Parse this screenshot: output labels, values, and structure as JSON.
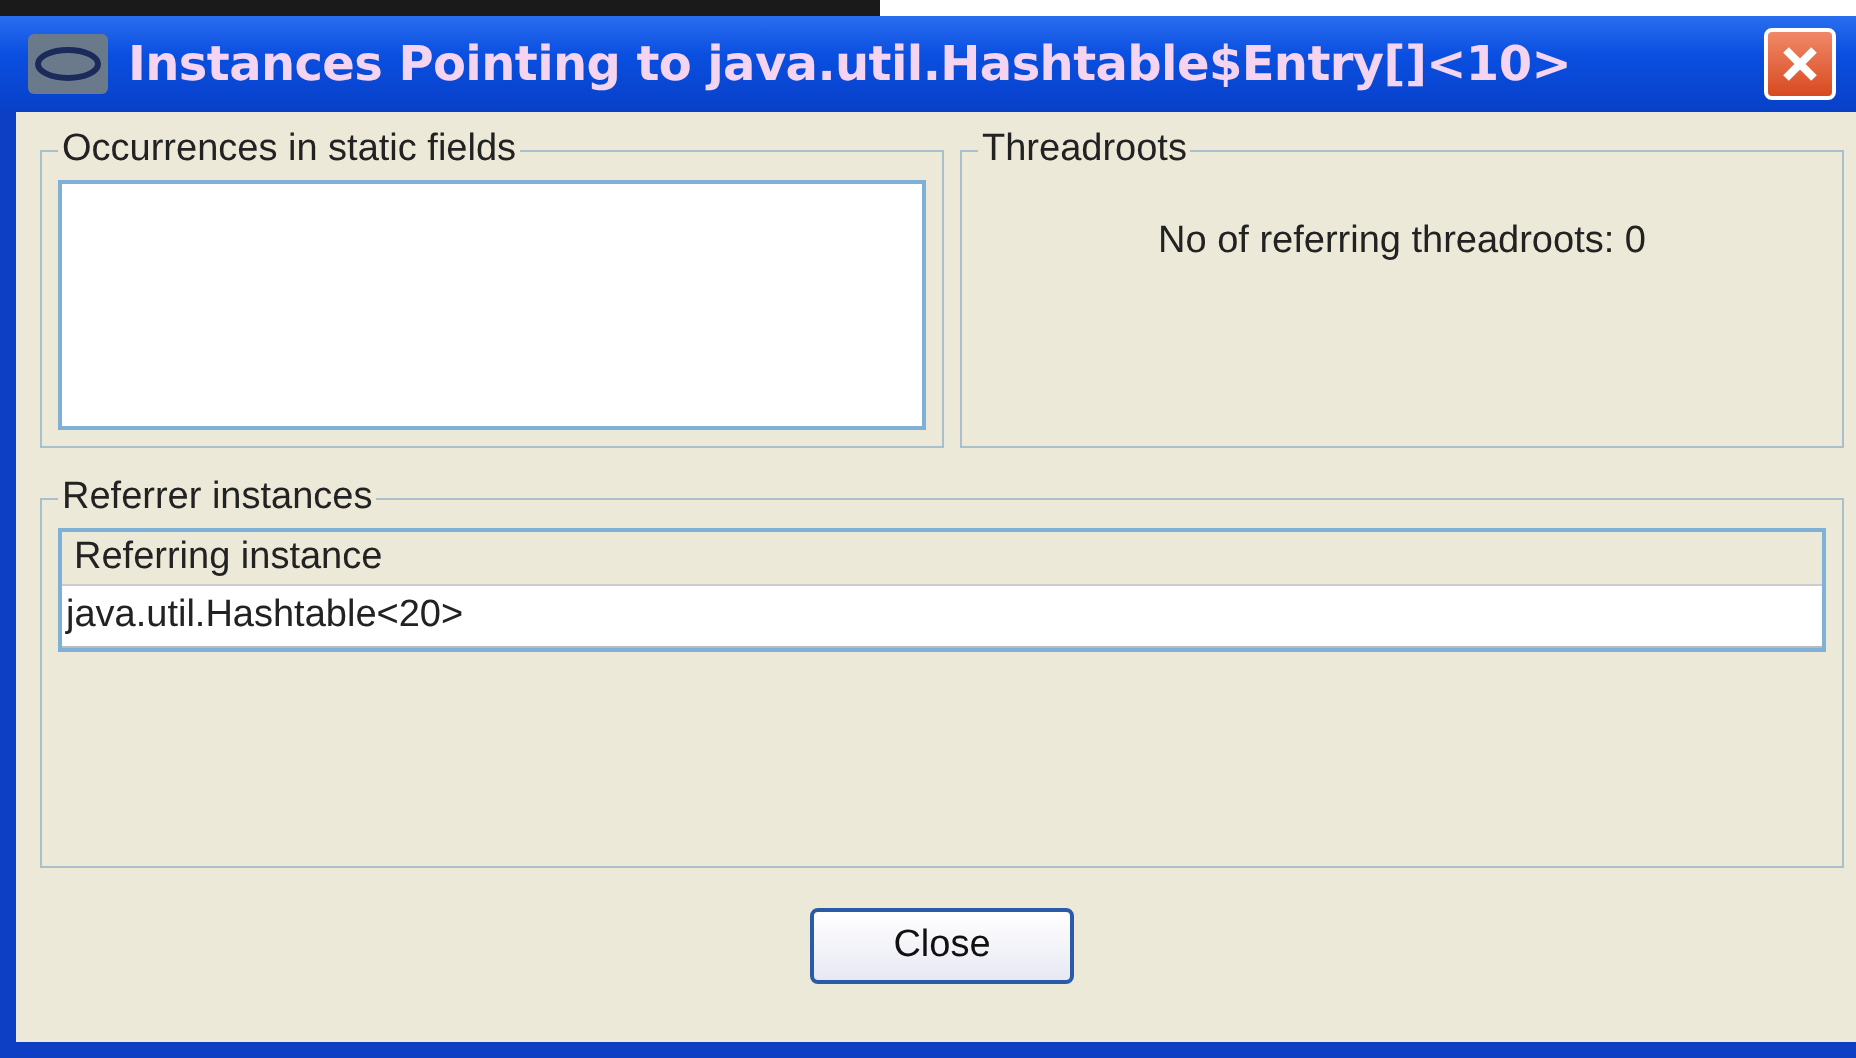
{
  "window": {
    "title": "Instances Pointing to java.util.Hashtable$Entry[]<10>"
  },
  "static_fields": {
    "title": "Occurrences in static fields"
  },
  "threadroots": {
    "title": "Threadroots",
    "text": "No of referring threadroots: 0"
  },
  "referrers": {
    "title": "Referrer instances",
    "columns": [
      "Referring instance"
    ],
    "rows": [
      [
        "java.util.Hashtable<20>"
      ]
    ]
  },
  "buttons": [
    "Close"
  ]
}
